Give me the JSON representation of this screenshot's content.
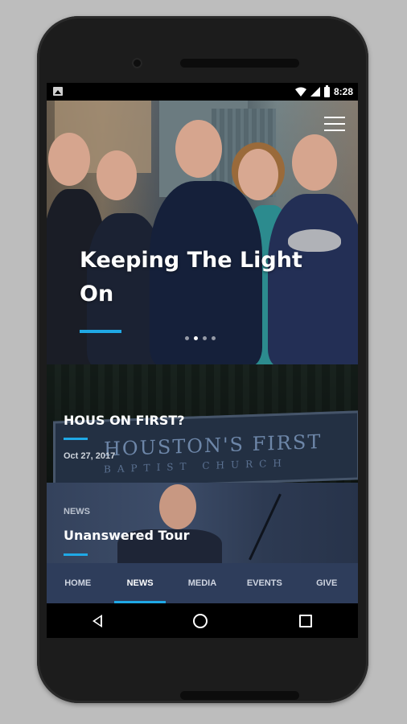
{
  "status_bar": {
    "time": "8:28"
  },
  "hero": {
    "title_line1": "Keeping The Light",
    "title_line2": "On",
    "carousel_dots": 4,
    "active_dot": 2,
    "accent_color": "#1fa9e6"
  },
  "cards": [
    {
      "title": "HOUS ON FIRST?",
      "meta": "Oct 27, 2017",
      "sign_text": "HOUSTON'S FIRST",
      "sign_sub": "BAPTIST CHURCH"
    },
    {
      "category": "NEWS",
      "title": "Unanswered Tour"
    }
  ],
  "tabs": [
    {
      "label": "HOME"
    },
    {
      "label": "NEWS",
      "active": true
    },
    {
      "label": "MEDIA"
    },
    {
      "label": "EVENTS"
    },
    {
      "label": "GIVE"
    }
  ],
  "icons": {
    "menu": "hamburger-icon",
    "back": "back-icon",
    "home": "home-icon",
    "recent": "recents-icon"
  }
}
